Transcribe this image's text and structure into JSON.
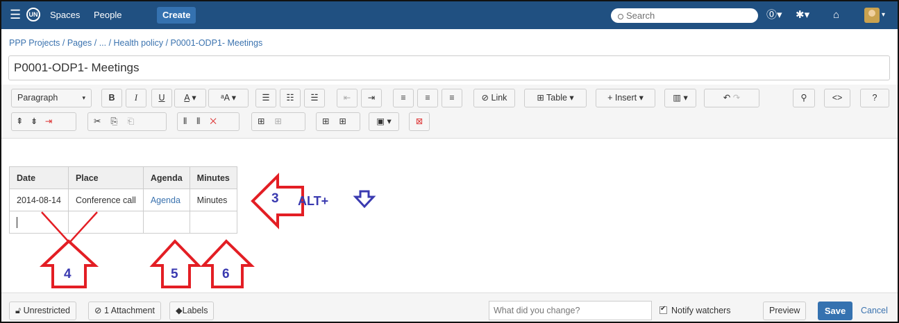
{
  "nav": {
    "spaces": "Spaces",
    "people": "People",
    "create": "Create",
    "search_placeholder": "Search"
  },
  "breadcrumb": "PPP Projects / Pages / ... / Health policy / P0001-ODP1- Meetings",
  "page_title": "P0001-ODP1- Meetings",
  "toolbar": {
    "paragraph": "Paragraph",
    "link": "Link",
    "table": "Table",
    "insert": "Insert"
  },
  "table": {
    "headers": [
      "Date",
      "Place",
      "Agenda",
      "Minutes"
    ],
    "rows": [
      [
        "2014-08-14",
        "Conference call",
        "Agenda",
        "Minutes"
      ],
      [
        "",
        "",
        "",
        ""
      ]
    ]
  },
  "annotations": {
    "n3": "3",
    "n4": "4",
    "n5": "5",
    "n6": "6",
    "alt": "ALT+"
  },
  "footer": {
    "restrictions": "Unrestricted",
    "attachments": "1 Attachment",
    "labels": "Labels",
    "change_placeholder": "What did you change?",
    "notify": "Notify watchers",
    "preview": "Preview",
    "save": "Save",
    "cancel": "Cancel"
  },
  "colors": {
    "topbar": "#205081",
    "primary": "#3572b0",
    "annotation_red": "#e31e24",
    "annotation_blue": "#3a3ab0"
  }
}
